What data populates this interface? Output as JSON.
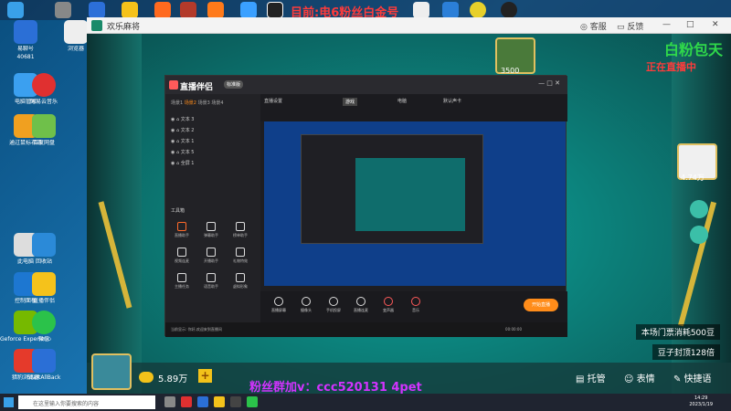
{
  "desktop": {
    "top_title": "目前:电6粉丝白金号",
    "icons": [
      {
        "label": "易聊号",
        "sub": "40681"
      },
      {
        "label": "电脑管家"
      },
      {
        "label": "腾讯软件管家"
      },
      {
        "label": "百度网盘"
      },
      {
        "label": "网易云音乐"
      },
      {
        "label": "直播伴侣"
      },
      {
        "label": "Geforce Experience"
      },
      {
        "label": "微信"
      },
      {
        "label": "StartAllBack"
      },
      {
        "label": "猎豹浏览器"
      },
      {
        "label": "此电脑"
      },
      {
        "label": "回收站"
      },
      {
        "label": "控制面板"
      }
    ],
    "left_labels": [
      "通过鼠标右击",
      "1654",
      "浏览器"
    ]
  },
  "game_window": {
    "title": "欢乐麻将",
    "menu_kf": "客服",
    "menu_fk": "反馈",
    "top_right_overlay": "白粉包天",
    "top_right_sub": "正在直播中",
    "player_top_score": "3500",
    "player_right_score": "4.74万",
    "hud_ticket": "本场门票消耗500豆",
    "hud_cap": "豆子封顶128倍",
    "coins": "5.89万",
    "plus": "+",
    "bottom_buttons": [
      "托管",
      "表情",
      "快捷语"
    ]
  },
  "obs_app": {
    "logo": "直播伴侣",
    "badge": "标准版",
    "tabs": [
      "场景1",
      "场景2",
      "场景3",
      "场景4"
    ],
    "layers": [
      "文本 3",
      "文本 2",
      "文本 1",
      "文本 5",
      "全屏 1"
    ],
    "tools_title": "工具箱",
    "tools": [
      "直播助手",
      "弹幕助手",
      "榜单助手",
      "视频连麦",
      "开播助手",
      "礼物特效",
      "主播任务",
      "语音助手",
      "虚拟形象"
    ],
    "top_tags": [
      "直播设置",
      "游戏",
      "电脑",
      "默认声卡"
    ],
    "bottom_tools": [
      "直播屏幕",
      "摄像头",
      "手机投屏",
      "直播连麦",
      "变声器",
      "音乐"
    ],
    "live_button": "开始直播",
    "time": "00:00:00",
    "status": "当前显示: 你好,欢迎来到直播间"
  },
  "taskbar": {
    "search_placeholder": "在这里输入你要搜索的内容",
    "time": "14:29",
    "date": "2023/1/19"
  },
  "watermark": "粉丝群加v：ccc520131 4pet"
}
